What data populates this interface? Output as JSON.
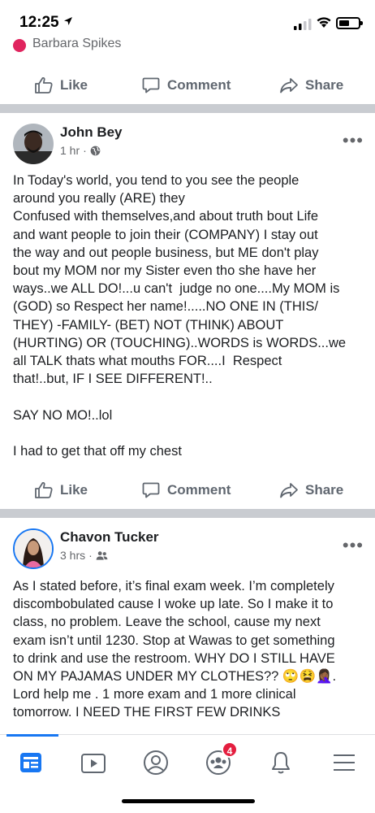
{
  "status_bar": {
    "time": "12:25"
  },
  "previous_post": {
    "reactor_name": "Barbara Spikes",
    "actions": {
      "like": "Like",
      "comment": "Comment",
      "share": "Share"
    }
  },
  "posts": [
    {
      "author": "John Bey",
      "time": "1 hr",
      "audience_icon": "globe-icon",
      "body": "In Today's world, you tend to you see the people\naround you really (ARE) they\nConfused with themselves,and about truth bout Life\nand want people to join their (COMPANY) I stay out\nthe way and out people business, but ME don't play\nbout my MOM nor my Sister even tho she have her\nways..we ALL DO!...u can't  judge no one....My MOM is\n(GOD) so Respect her name!.....NO ONE IN (THIS/\nTHEY) -FAMILY- (BET) NOT (THINK) ABOUT\n(HURTING) OR (TOUCHING)..WORDS is WORDS...we\nall TALK thats what mouths FOR....I  Respect\nthat!..but, IF I SEE DIFFERENT!..\n\nSAY NO MO!..lol\n\nI had to get that off my chest",
      "actions": {
        "like": "Like",
        "comment": "Comment",
        "share": "Share"
      }
    },
    {
      "author": "Chavon Tucker",
      "time": "3 hrs",
      "audience_icon": "friends-icon",
      "body": "As I stated before, it’s final exam week. I’m completely\ndiscombobulated cause I woke up late. So I make it to\nclass, no problem. Leave the school, cause my next\nexam isn’t until 1230. Stop at Wawas to get something\nto drink and use the restroom. WHY DO I STILL HAVE\nON MY PAJAMAS UNDER MY CLOTHES?? 🙄😫🤦🏾‍♀️.\nLord help me . 1 more exam and 1 more clinical\ntomorrow. I NEED THE FIRST FEW DRINKS"
    }
  ],
  "bottom_nav": {
    "items": [
      "news-feed-icon",
      "watch-icon",
      "profile-icon",
      "groups-icon",
      "notifications-icon",
      "menu-icon"
    ],
    "groups_badge": "4",
    "active_color": "#1877f2"
  }
}
